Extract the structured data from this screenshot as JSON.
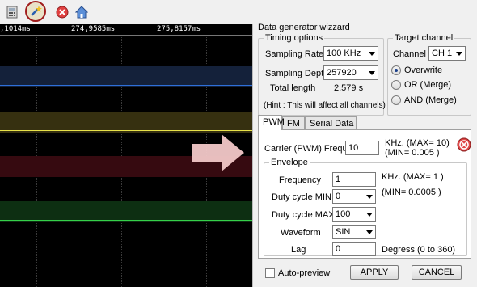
{
  "toolbar": {
    "icons": [
      "calculator-icon",
      "wand-icon",
      "stop-icon",
      "home-icon"
    ]
  },
  "scope": {
    "timestamps": [
      ",1014ms",
      "274,9585ms",
      "275,8157ms"
    ],
    "band_colors": {
      "blue": "#1a2a44",
      "yellow": "#3a3412",
      "red": "#3a0c12",
      "green": "#0f3214"
    },
    "line_colors": {
      "blue": "#2e6fd8",
      "yellow": "#e8e24a",
      "red": "#e03b3b",
      "green": "#35d04a"
    }
  },
  "wizard": {
    "title": "Data generator wizzard",
    "timing": {
      "legend": "Timing options",
      "sampling_rate_label": "Sampling Rate",
      "sampling_rate_value": "100 KHz",
      "sampling_depth_label": "Sampling Depth",
      "sampling_depth_value": "257920",
      "total_length_label": "Total length",
      "total_length_value": "2,579 s",
      "hint": "(Hint : This will affect all channels)"
    },
    "target": {
      "legend": "Target channel",
      "channel_label": "Channel",
      "channel_value": "CH 1",
      "options": [
        "Overwrite",
        "OR (Merge)",
        "AND (Merge)"
      ],
      "selected": "Overwrite"
    },
    "tabs": [
      "PWM",
      "FM",
      "Serial Data"
    ],
    "active_tab": "PWM",
    "pwm": {
      "carrier_label": "Carrier (PWM) Frequency",
      "carrier_value": "10",
      "carrier_unit": "KHz. (MAX= 10)",
      "carrier_min": "(MIN= 0.005 )",
      "envelope_legend": "Envelope",
      "frequency_label": "Frequency",
      "frequency_value": "1",
      "frequency_unit": "KHz. (MAX= 1 )",
      "frequency_min": "(MIN= 0.0005 )",
      "duty_min_label": "Duty cycle MIN",
      "duty_min_value": "0",
      "duty_max_label": "Duty cycle MAX",
      "duty_max_value": "100",
      "waveform_label": "Waveform",
      "waveform_value": "SIN",
      "lag_label": "Lag",
      "lag_value": "0",
      "lag_unit": "Degress (0 to 360)"
    },
    "footer": {
      "auto_preview_label": "Auto-preview",
      "apply_label": "APPLY",
      "cancel_label": "CANCEL"
    }
  }
}
